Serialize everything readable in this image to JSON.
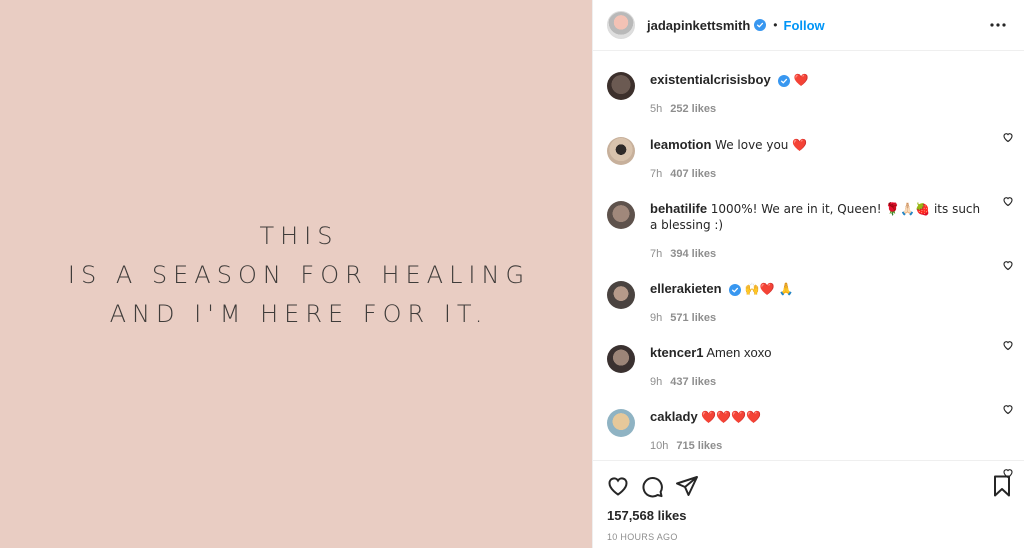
{
  "post": {
    "quote_lines": [
      "THIS",
      "IS A SEASON FOR HEALING",
      "AND I'M HERE FOR IT."
    ],
    "background": "#e9cdc3"
  },
  "header": {
    "username": "jadapinkettsmith",
    "verified": true,
    "separator": "•",
    "follow_label": "Follow",
    "more_icon": "ellipsis-icon"
  },
  "comments": [
    {
      "user": "existentialcrisisboy",
      "verified": true,
      "text": "❤️",
      "time": "5h",
      "likes": "252 likes",
      "avatar_color": "#5a4a44"
    },
    {
      "user": "leamotion",
      "verified": false,
      "text": "We love you ❤️",
      "time": "7h",
      "likes": "407 likes",
      "avatar_color": "#c9b29a"
    },
    {
      "user": "behatilife",
      "verified": false,
      "text": "1000%! We are in it, Queen! 🌹🙏🏻🍓 its such a blessing :)",
      "time": "7h",
      "likes": "394 likes",
      "avatar_color": "#8b7d74"
    },
    {
      "user": "ellerakieten",
      "verified": true,
      "text": "🙌❤️ 🙏",
      "time": "9h",
      "likes": "571 likes",
      "avatar_color": "#6e6661"
    },
    {
      "user": "ktencer1",
      "verified": false,
      "text": "Amen xoxo",
      "time": "9h",
      "likes": "437 likes",
      "avatar_color": "#4d4240"
    },
    {
      "user": "caklady",
      "verified": false,
      "text": "❤️❤️❤️❤️",
      "time": "10h",
      "likes": "715 likes",
      "avatar_color": "#c4b38a"
    }
  ],
  "actions": {
    "like_icon": "heart-icon",
    "comment_icon": "comment-icon",
    "share_icon": "paper-plane-icon",
    "save_icon": "bookmark-icon"
  },
  "likes_count": "157,568 likes",
  "time_ago": "10 HOURS AGO"
}
